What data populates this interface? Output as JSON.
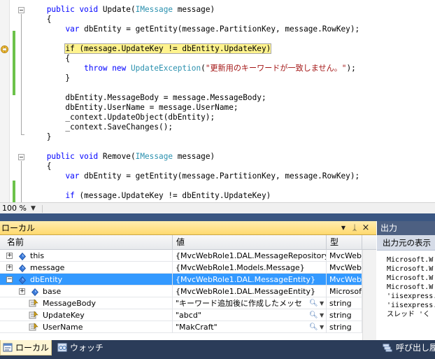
{
  "editor": {
    "lines": [
      {
        "parts": [
          {
            "t": "    "
          },
          {
            "t": "public",
            "c": "kw"
          },
          {
            "t": " "
          },
          {
            "t": "void",
            "c": "kw"
          },
          {
            "t": " Update("
          },
          {
            "t": "IMessage",
            "c": "ty"
          },
          {
            "t": " message)"
          }
        ]
      },
      {
        "parts": [
          {
            "t": "    {"
          }
        ]
      },
      {
        "parts": [
          {
            "t": "        "
          },
          {
            "t": "var",
            "c": "kw"
          },
          {
            "t": " dbEntity = getEntity(message.PartitionKey, message.RowKey);"
          }
        ]
      },
      {
        "parts": [
          {
            "t": ""
          }
        ]
      },
      {
        "parts": [
          {
            "t": "        "
          },
          {
            "t": "if (message.UpdateKey != dbEntity.UpdateKey)",
            "c": "hl"
          }
        ]
      },
      {
        "parts": [
          {
            "t": "        {"
          }
        ]
      },
      {
        "parts": [
          {
            "t": "            "
          },
          {
            "t": "throw",
            "c": "kw"
          },
          {
            "t": " "
          },
          {
            "t": "new",
            "c": "kw"
          },
          {
            "t": " "
          },
          {
            "t": "UpdateException",
            "c": "ty"
          },
          {
            "t": "("
          },
          {
            "t": "\"更新用のキーワードが一致しません。\"",
            "c": "st"
          },
          {
            "t": ");"
          }
        ]
      },
      {
        "parts": [
          {
            "t": "        }"
          }
        ]
      },
      {
        "parts": [
          {
            "t": ""
          }
        ]
      },
      {
        "parts": [
          {
            "t": "        dbEntity.MessageBody = message.MessageBody;"
          }
        ]
      },
      {
        "parts": [
          {
            "t": "        dbEntity.UserName = message.UserName;"
          }
        ]
      },
      {
        "parts": [
          {
            "t": "        _context.UpdateObject(dbEntity);"
          }
        ]
      },
      {
        "parts": [
          {
            "t": "        _context.SaveChanges();"
          }
        ]
      },
      {
        "parts": [
          {
            "t": "    }"
          }
        ]
      },
      {
        "parts": [
          {
            "t": ""
          }
        ]
      },
      {
        "parts": [
          {
            "t": "    "
          },
          {
            "t": "public",
            "c": "kw"
          },
          {
            "t": " "
          },
          {
            "t": "void",
            "c": "kw"
          },
          {
            "t": " Remove("
          },
          {
            "t": "IMessage",
            "c": "ty"
          },
          {
            "t": " message)"
          }
        ]
      },
      {
        "parts": [
          {
            "t": "    {"
          }
        ]
      },
      {
        "parts": [
          {
            "t": "        "
          },
          {
            "t": "var",
            "c": "kw"
          },
          {
            "t": " dbEntity = getEntity(message.PartitionKey, message.RowKey);"
          }
        ]
      },
      {
        "parts": [
          {
            "t": ""
          }
        ]
      },
      {
        "parts": [
          {
            "t": "        "
          },
          {
            "t": "if",
            "c": "kw"
          },
          {
            "t": " (message.UpdateKey != dbEntity.UpdateKey)"
          }
        ]
      }
    ],
    "zoom": "100 %",
    "colors": {
      "keyword": "#0000ff",
      "type": "#2b91af",
      "string": "#a31515",
      "current_statement": "#fff38d",
      "change_bar": "#6cc24a"
    }
  },
  "locals": {
    "title": "ローカル",
    "title_buttons": {
      "dropdown": "▼",
      "pin": "ᛣ",
      "close": "×"
    },
    "columns": {
      "name": "名前",
      "value": "値",
      "type": "型"
    },
    "rows": [
      {
        "expander": "+",
        "name": "this",
        "value": "{MvcWebRole1.DAL.MessageRepository}",
        "type": "MvcWeb",
        "icon": "variable-icon"
      },
      {
        "expander": "+",
        "name": "message",
        "value": "{MvcWebRole1.Models.Message}",
        "type": "MvcWeb",
        "icon": "variable-icon"
      },
      {
        "expander": "−",
        "name": "dbEntity",
        "value": "{MvcWebRole1.DAL.MessageEntity}",
        "type": "MvcWeb",
        "icon": "variable-icon",
        "selected": true
      },
      {
        "expander": "+",
        "name": "base",
        "value": "{MvcWebRole1.DAL.MessageEntity}",
        "type": "Microsof",
        "icon": "variable-icon"
      },
      {
        "expander": "",
        "name": "MessageBody",
        "value": "\"キーワード追加後に作成したメッセ",
        "type": "string",
        "icon": "property-icon"
      },
      {
        "expander": "",
        "name": "UpdateKey",
        "value": "\"abcd\"",
        "type": "string",
        "icon": "property-icon"
      },
      {
        "expander": "",
        "name": "UserName",
        "value": "\"MakCraft\"",
        "type": "string",
        "icon": "property-icon"
      }
    ]
  },
  "output": {
    "title": "出力",
    "source_label": "出力元の表示",
    "lines": [
      "Microsoft.W",
      "Microsoft.W",
      "Microsoft.W",
      "Microsoft.W",
      "'iisexpress.",
      "'iisexpress.",
      "スレッド 'く"
    ]
  },
  "tabs": {
    "locals": "ローカル",
    "watch": "ウォッチ",
    "call_stack": "呼び出し履"
  }
}
